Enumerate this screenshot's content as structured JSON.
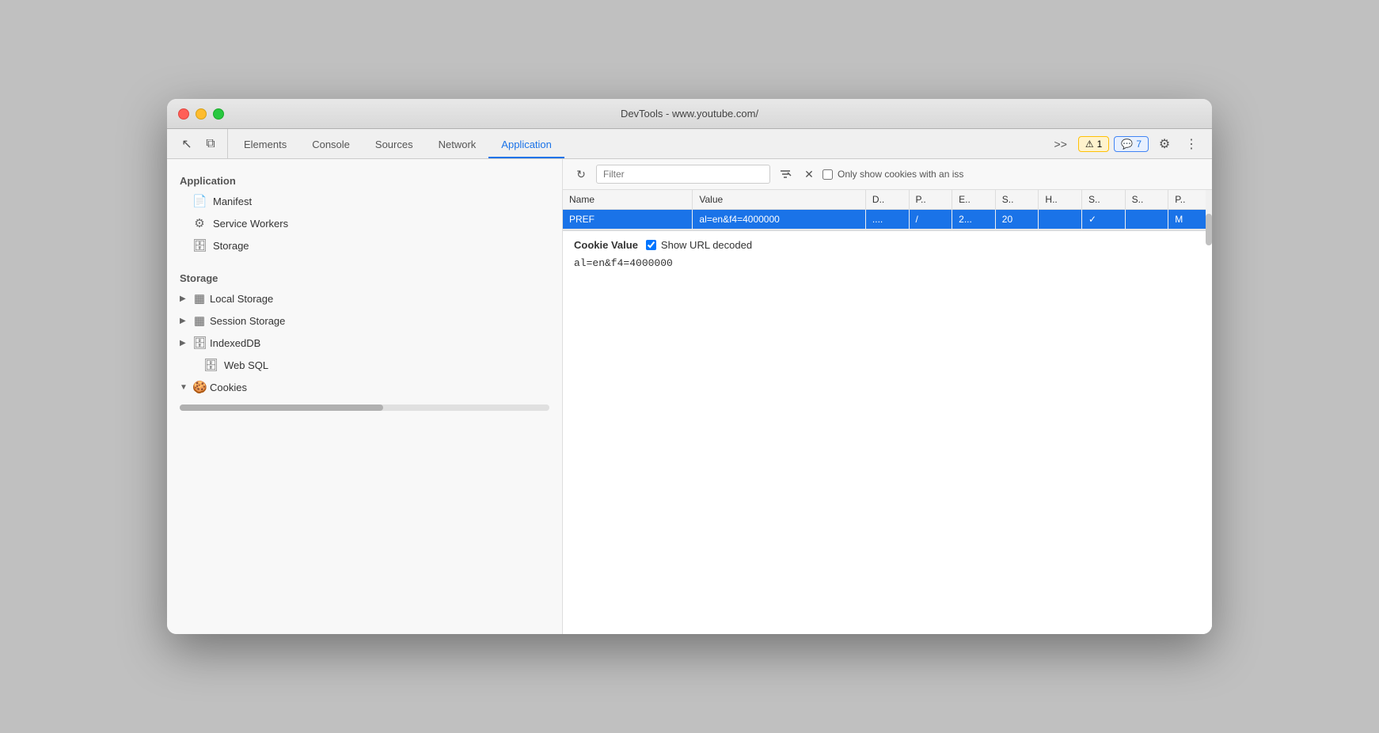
{
  "titlebar": {
    "title": "DevTools - www.youtube.com/"
  },
  "tabs": {
    "items": [
      {
        "label": "Elements",
        "active": false
      },
      {
        "label": "Console",
        "active": false
      },
      {
        "label": "Sources",
        "active": false
      },
      {
        "label": "Network",
        "active": false
      },
      {
        "label": "Application",
        "active": true
      }
    ],
    "more_label": ">>",
    "warning_count": "1",
    "chat_count": "7"
  },
  "sidebar": {
    "application_section": "Application",
    "storage_section": "Storage",
    "items": {
      "manifest": "Manifest",
      "service_workers": "Service Workers",
      "storage": "Storage",
      "local_storage": "Local Storage",
      "session_storage": "Session Storage",
      "indexeddb": "IndexedDB",
      "web_sql": "Web SQL",
      "cookies": "Cookies"
    }
  },
  "toolbar": {
    "filter_placeholder": "Filter",
    "only_issues_label": "Only show cookies with an iss"
  },
  "table": {
    "columns": [
      "Name",
      "Value",
      "D..",
      "P..",
      "E..",
      "S..",
      "H..",
      "S..",
      "S..",
      "P.."
    ],
    "row": {
      "name": "PREF",
      "value": "al=en&f4=4000000",
      "domain": "....",
      "path": "/",
      "expires": "2...",
      "size": "20",
      "httponly": "",
      "secure": "✓",
      "samesite": "",
      "priority": "M"
    }
  },
  "cookie_value": {
    "label": "Cookie Value",
    "show_url_decoded_label": "Show URL decoded",
    "value": "al=en&f4=4000000"
  },
  "icons": {
    "cursor": "↖",
    "layers": "⧉",
    "reload": "↻",
    "filter": "≡",
    "clear": "✕",
    "gear": "⚙",
    "dots": "⋮",
    "warning": "⚠",
    "chat": "💬"
  }
}
